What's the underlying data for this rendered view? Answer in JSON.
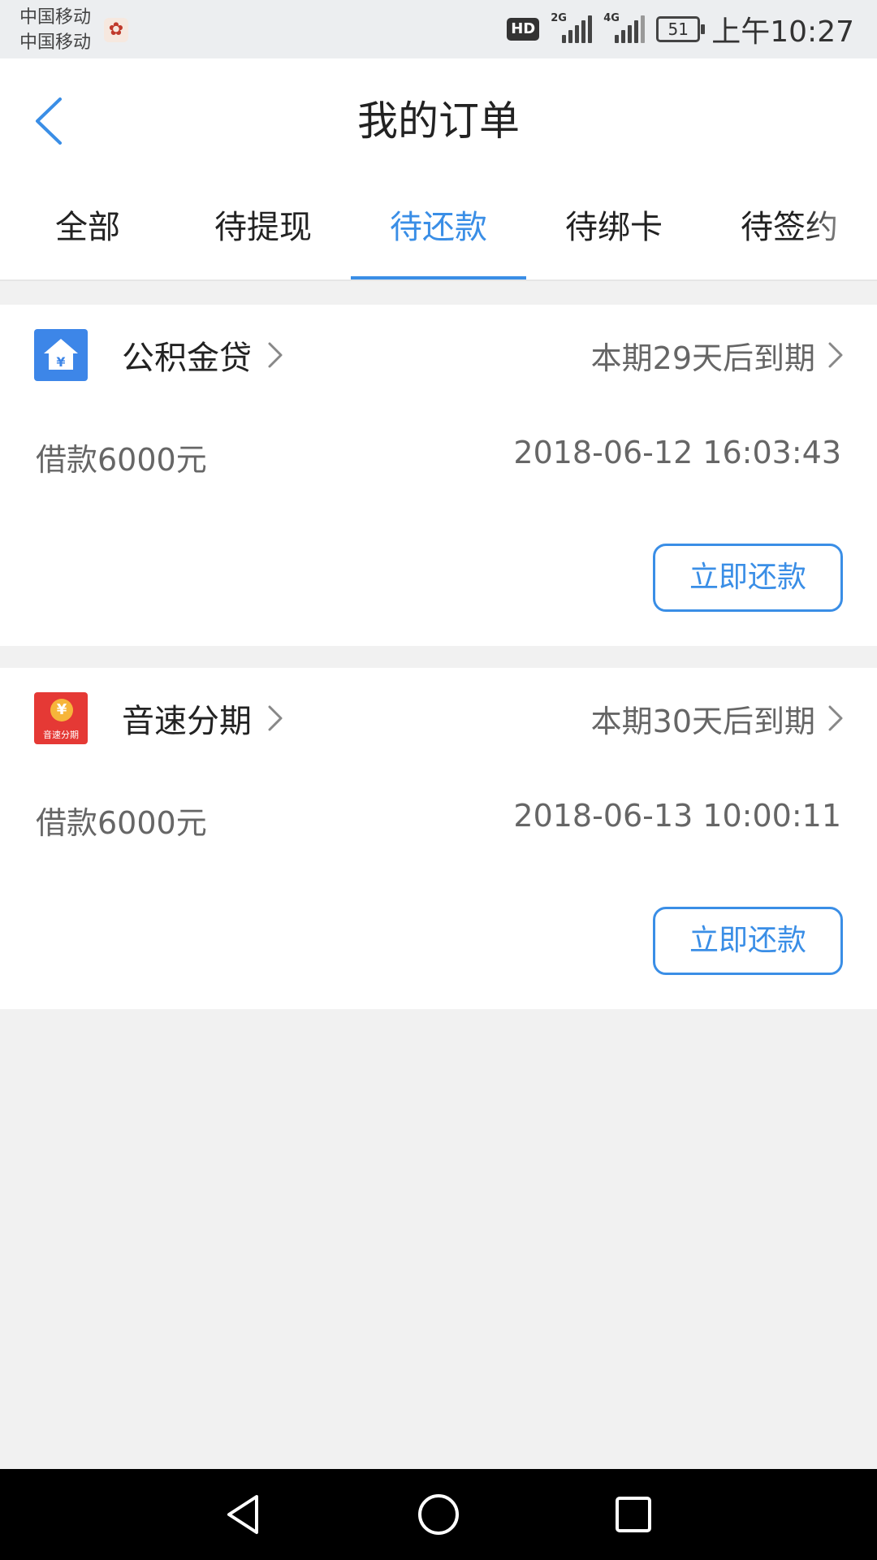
{
  "status_bar": {
    "carrier_1": "中国移动",
    "carrier_2": "中国移动",
    "hd_label": "HD",
    "network_1": "2G",
    "network_2": "4G",
    "battery_level": "51",
    "time": "上午10:27"
  },
  "header": {
    "title": "我的订单",
    "back_icon": "chevron-left-icon"
  },
  "tabs": [
    {
      "label": "全部",
      "active": false
    },
    {
      "label": "待提现",
      "active": false
    },
    {
      "label": "待还款",
      "active": true
    },
    {
      "label": "待绑卡",
      "active": false
    },
    {
      "label": "待签约",
      "active": false
    }
  ],
  "orders": [
    {
      "product_name": "公积金贷",
      "icon": "house-yuan-icon",
      "due_text": "本期29天后到期",
      "loan_amount": "借款6000元",
      "datetime": "2018-06-12 16:03:43",
      "button_label": "立即还款"
    },
    {
      "product_name": "音速分期",
      "icon": "yinsu-fenqi-logo",
      "icon_caption": "音速分期",
      "due_text": "本期30天后到期",
      "loan_amount": "借款6000元",
      "datetime": "2018-06-13 10:00:11",
      "button_label": "立即还款"
    }
  ],
  "colors": {
    "accent": "#3a8ee6",
    "page_background": "#f1f1f1",
    "icon_blue": "#3d86e8",
    "icon_red": "#e53935"
  }
}
